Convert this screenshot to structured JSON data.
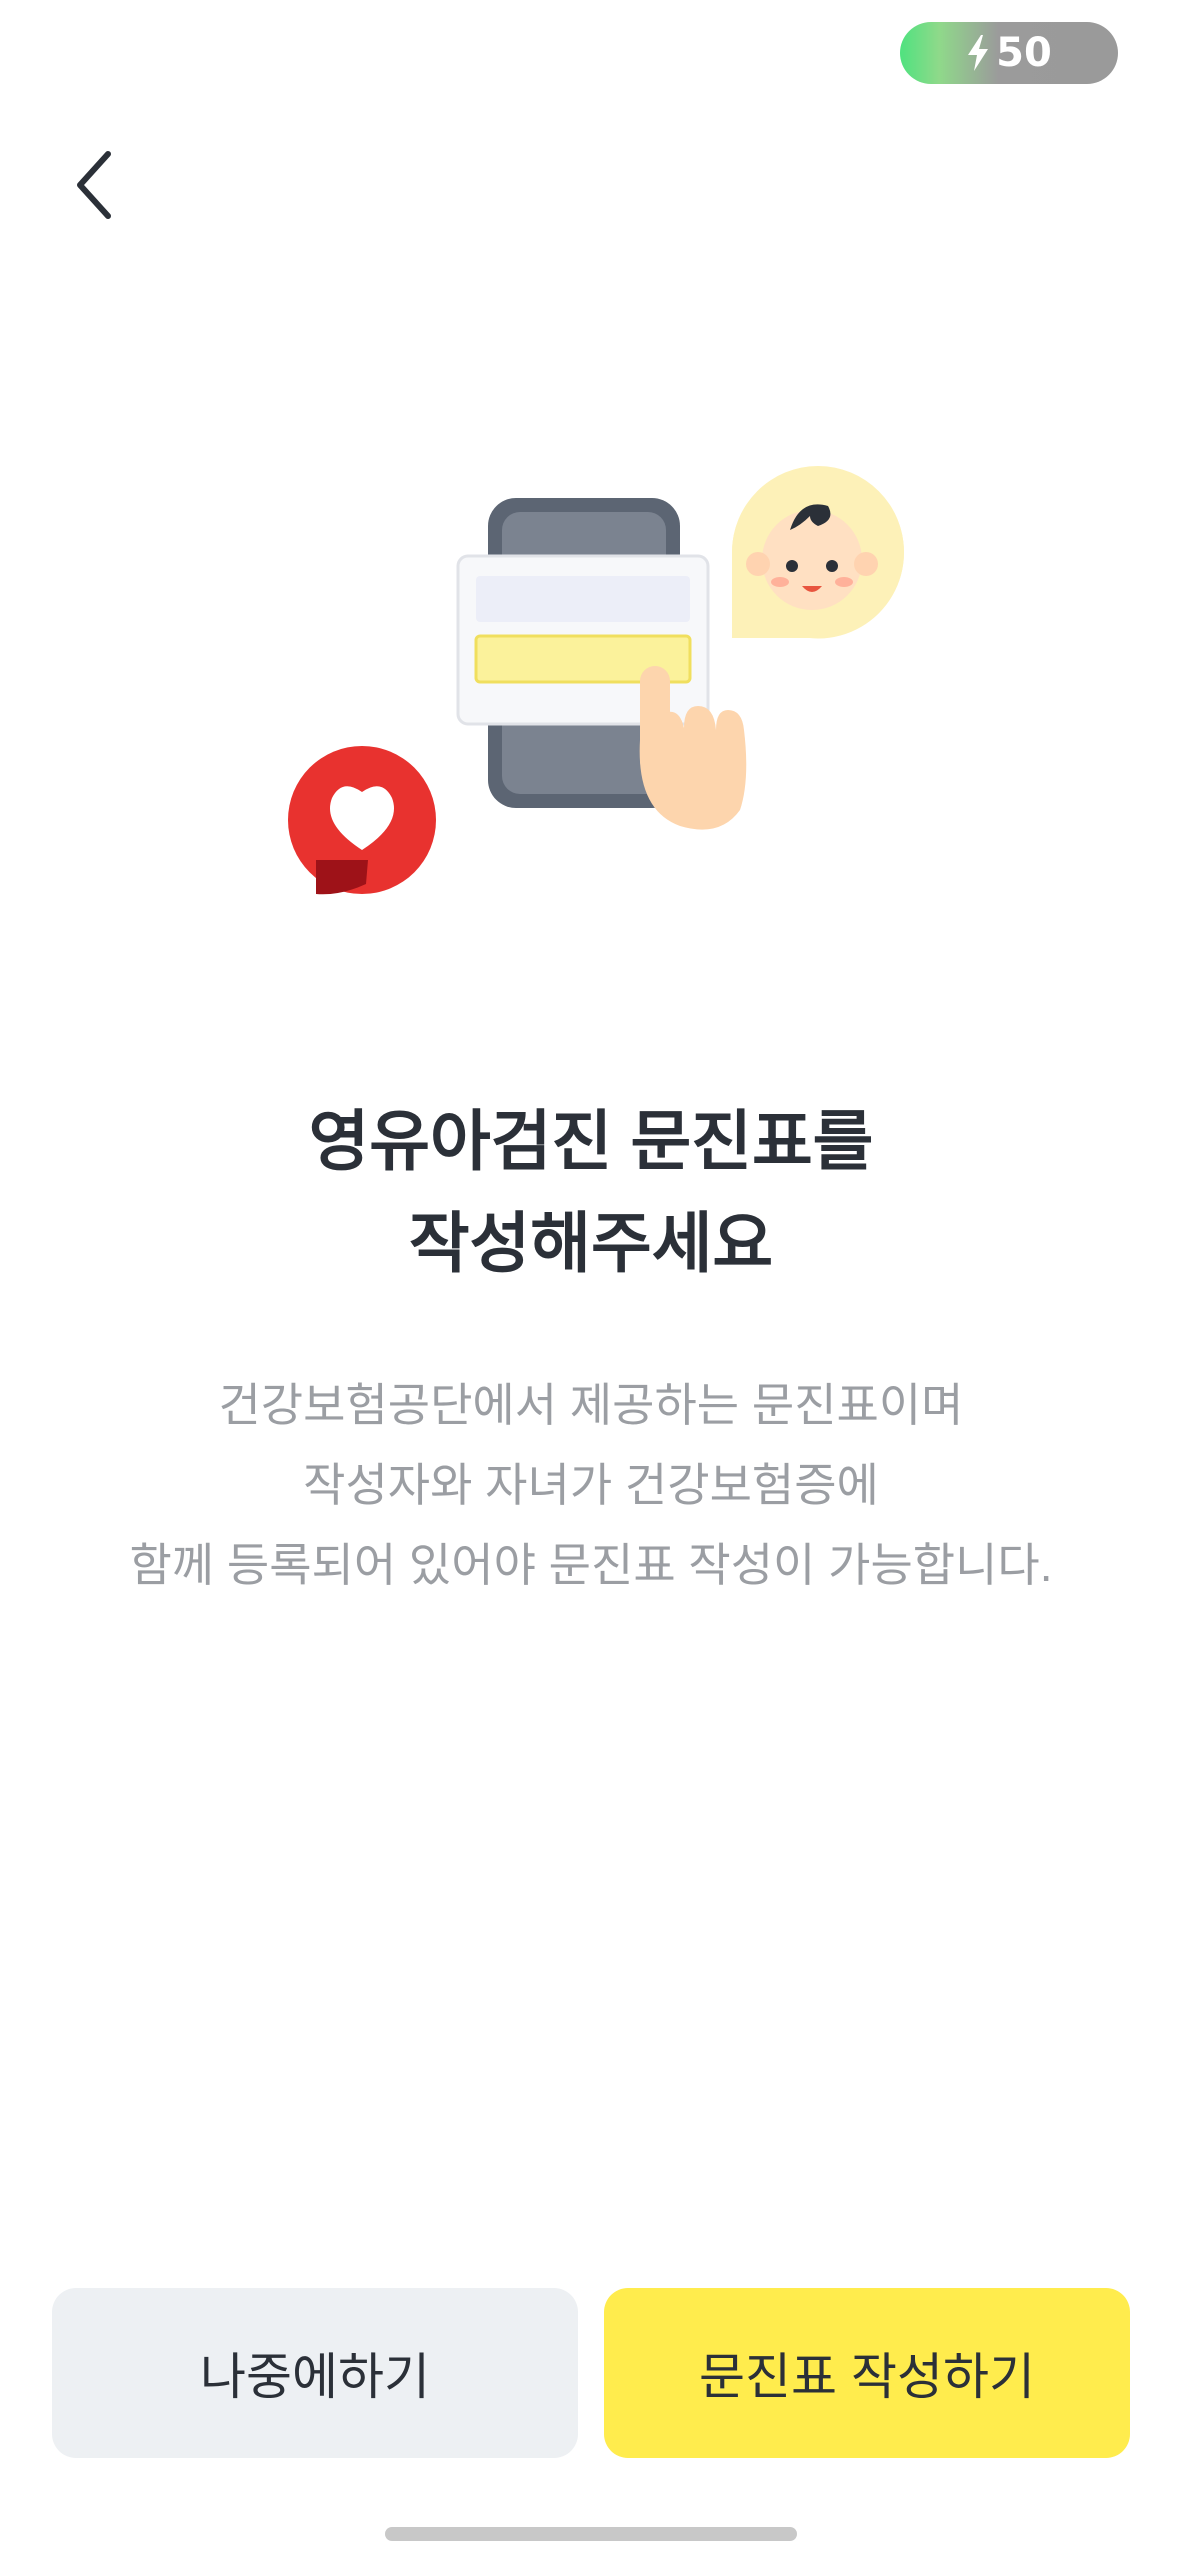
{
  "status": {
    "energy_value": "50",
    "energy_icon": "lightning-icon"
  },
  "nav": {
    "back_icon": "chevron-left-icon"
  },
  "illustration": {
    "icons": [
      "baby-face-icon",
      "phone-form-icon",
      "pointing-hand-icon",
      "heart-speech-bubble-icon"
    ]
  },
  "content": {
    "headline_line1": "영유아검진 문진표를",
    "headline_line2": "작성해주세요",
    "description_line1": "건강보험공단에서 제공하는 문진표이며",
    "description_line2": "작성자와 자녀가 건강보험증에",
    "description_line3": "함께 등록되어 있어야 문진표 작성이 가능합니다."
  },
  "actions": {
    "later_label": "나중에하기",
    "write_label": "문진표 작성하기"
  },
  "colors": {
    "primary_button": "#ffec4d",
    "secondary_button": "#edf0f3",
    "heart_red": "#e8322f",
    "text_dark": "#2b3038",
    "text_muted": "#9b9ea3"
  }
}
